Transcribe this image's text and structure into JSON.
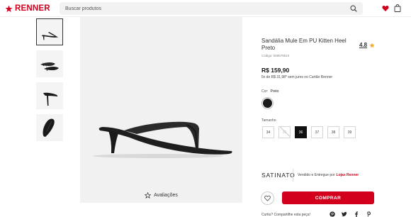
{
  "header": {
    "logo_text": "RENNER",
    "search_placeholder": "Buscar produtos",
    "icons": [
      "search-icon",
      "heart-icon",
      "shopping-bag-icon"
    ]
  },
  "gallery": {
    "thumbnails": [
      "thumbnail-side-view",
      "thumbnail-pair-top",
      "thumbnail-heel-back",
      "thumbnail-top-view"
    ],
    "selected_thumbnail": 0,
    "reviews_label": "Avaliações"
  },
  "product": {
    "title": "Sandália Mule Em PU Kitten Heel Preto",
    "rating": "4.8",
    "code": "Código: 559578610",
    "price": "R$ 159,90",
    "installments": "5x de R$ 31,98* sem juros no Cartão Renner",
    "color_label": "Cor:",
    "color_value": "Preto",
    "color_hex": "#1a1a1a",
    "size_label": "Tamanho",
    "sizes": [
      {
        "label": "34",
        "state": "available"
      },
      {
        "label": "35",
        "state": "unavailable"
      },
      {
        "label": "36",
        "state": "selected"
      },
      {
        "label": "37",
        "state": "available"
      },
      {
        "label": "38",
        "state": "available"
      },
      {
        "label": "39",
        "state": "available"
      }
    ],
    "brand": "SATINATO",
    "sold_by_text": "Vendido e Entregue por",
    "sold_by_store": "Lojas Renner",
    "buy_label": "COMPRAR",
    "share_text": "Curtiu? Compartilhe esta peça!",
    "share_icons": [
      "pinterest-icon",
      "twitter-icon",
      "facebook-icon",
      "pinterest-p-icon"
    ]
  },
  "colors": {
    "brand_red": "#d2001d",
    "rating_star": "#f5a623"
  }
}
